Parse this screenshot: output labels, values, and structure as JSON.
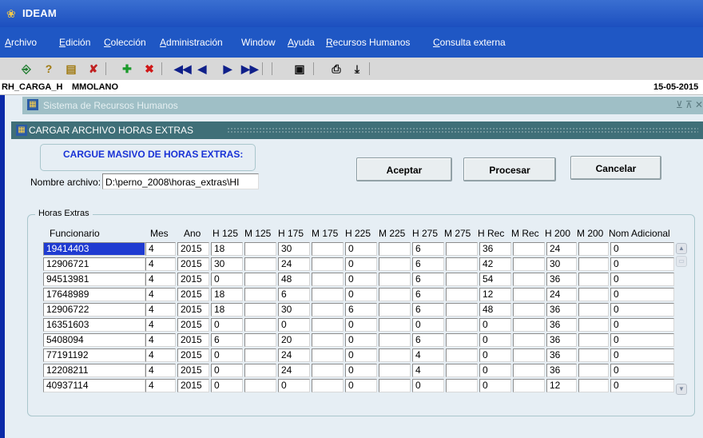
{
  "app": {
    "title": "IDEAM"
  },
  "menu": [
    {
      "label": "Archivo",
      "u": "A",
      "rest": "rchivo"
    },
    {
      "label": "Edición",
      "u": "E",
      "rest": "dición"
    },
    {
      "label": "Colección",
      "u": "C",
      "rest": "olección"
    },
    {
      "label": "Administración",
      "u": "A",
      "rest": "dministración"
    },
    {
      "label": "Window",
      "u": "",
      "rest": "Window"
    },
    {
      "label": "Ayuda",
      "u": "A",
      "rest": "yuda"
    },
    {
      "label": "Recursos Humanos",
      "u": "R",
      "rest": "ecursos Humanos"
    },
    {
      "label": "Consulta externa",
      "u": "C",
      "rest": "onsulta externa"
    }
  ],
  "toolbar": {
    "icons": [
      "exit-icon",
      "query-icon",
      "execute-query-icon",
      "cancel-query-icon",
      "insert-record-icon",
      "delete-record-icon",
      "first-record-icon",
      "previous-record-icon",
      "next-record-icon",
      "last-record-icon",
      "save-icon",
      "print-icon",
      "download-icon"
    ]
  },
  "status": {
    "form": "RH_CARGA_H",
    "user": "MMOLANO",
    "date": "15-05-2015"
  },
  "outer_window": {
    "title": "Sistema de Recursos Humanos",
    "controls": "⊻ ⊼ ✕"
  },
  "dialog": {
    "title": "CARGAR ARCHIVO HORAS EXTRAS",
    "heading": "CARGUE MASIVO DE HORAS EXTRAS:",
    "file_label": "Nombre archivo:",
    "file_value": "D:\\perno_2008\\horas_extras\\HI",
    "buttons": {
      "accept": "Aceptar",
      "process": "Procesar",
      "cancel": "Cancelar"
    },
    "group_label": "Horas Extras"
  },
  "table": {
    "columns": [
      "Funcionario",
      "Mes",
      "Ano",
      "H 125",
      "M 125",
      "H 175",
      "M 175",
      "H 225",
      "M 225",
      "H 275",
      "M 275",
      "H Rec",
      "M Rec",
      "H 200",
      "M 200",
      "Nom Adicional"
    ],
    "rows": [
      [
        "19414403",
        "4",
        "2015",
        "18",
        "",
        "30",
        "",
        "0",
        "",
        "6",
        "",
        "36",
        "",
        "24",
        "",
        "0"
      ],
      [
        "12906721",
        "4",
        "2015",
        "30",
        "",
        "24",
        "",
        "0",
        "",
        "6",
        "",
        "42",
        "",
        "30",
        "",
        "0"
      ],
      [
        "94513981",
        "4",
        "2015",
        "0",
        "",
        "48",
        "",
        "0",
        "",
        "6",
        "",
        "54",
        "",
        "36",
        "",
        "0"
      ],
      [
        "17648989",
        "4",
        "2015",
        "18",
        "",
        "6",
        "",
        "0",
        "",
        "6",
        "",
        "12",
        "",
        "24",
        "",
        "0"
      ],
      [
        "12906722",
        "4",
        "2015",
        "18",
        "",
        "30",
        "",
        "6",
        "",
        "6",
        "",
        "48",
        "",
        "36",
        "",
        "0"
      ],
      [
        "16351603",
        "4",
        "2015",
        "0",
        "",
        "0",
        "",
        "0",
        "",
        "0",
        "",
        "0",
        "",
        "36",
        "",
        "0"
      ],
      [
        "5408094",
        "4",
        "2015",
        "6",
        "",
        "20",
        "",
        "0",
        "",
        "6",
        "",
        "0",
        "",
        "36",
        "",
        "0"
      ],
      [
        "77191192",
        "4",
        "2015",
        "0",
        "",
        "24",
        "",
        "0",
        "",
        "4",
        "",
        "0",
        "",
        "36",
        "",
        "0"
      ],
      [
        "12208211",
        "4",
        "2015",
        "0",
        "",
        "24",
        "",
        "0",
        "",
        "4",
        "",
        "0",
        "",
        "36",
        "",
        "0"
      ],
      [
        "40937114",
        "4",
        "2015",
        "0",
        "",
        "0",
        "",
        "0",
        "",
        "0",
        "",
        "0",
        "",
        "12",
        "",
        "0"
      ]
    ]
  }
}
